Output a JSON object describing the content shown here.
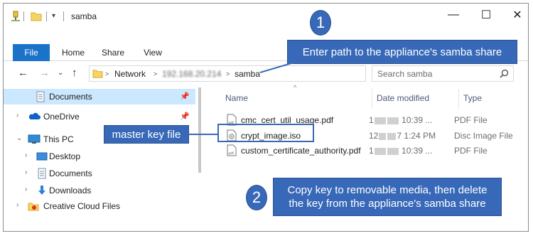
{
  "window": {
    "title": "samba",
    "controls": {
      "minimize": "—",
      "maximize": "☐",
      "close": "✕"
    }
  },
  "ribbon": {
    "tabs": [
      "File",
      "Home",
      "Share",
      "View"
    ]
  },
  "address": {
    "segments": [
      "Network",
      "192.168.20.214",
      "samba"
    ],
    "separator": ">",
    "search_placeholder": "Search samba"
  },
  "nav": {
    "items": [
      {
        "label": "Documents",
        "pinned": true,
        "selected": true
      },
      {
        "label": "OneDrive",
        "pinned": true
      },
      {
        "label": "This PC"
      },
      {
        "label": "Desktop"
      },
      {
        "label": "Documents"
      },
      {
        "label": "Downloads"
      },
      {
        "label": "Creative Cloud Files"
      }
    ]
  },
  "list": {
    "columns": {
      "name": "Name",
      "date": "Date modified",
      "type": "Type"
    },
    "files": [
      {
        "name": "cmc_cert_util_usage.pdf",
        "date_tail": "10:39 ...",
        "type": "PDF File",
        "icon": "pdf-file-icon"
      },
      {
        "name": "crypt_image.iso",
        "date_tail": "1:24 PM",
        "type": "Disc Image File",
        "icon": "disc-image-icon"
      },
      {
        "name": "custom_certificate_authority.pdf",
        "date_tail": "10:39 ...",
        "type": "PDF File",
        "icon": "pdf-file-icon"
      }
    ]
  },
  "callouts": {
    "step1_number": "1",
    "step1_text": "Enter path to the appliance's samba share",
    "master_key": "master key file",
    "step2_number": "2",
    "step2_text": "Copy key to removable media, then delete the key from the appliance's samba share"
  },
  "colors": {
    "accent": "#3869b8",
    "file_tab": "#1a73c9",
    "selection": "#cce8ff"
  }
}
